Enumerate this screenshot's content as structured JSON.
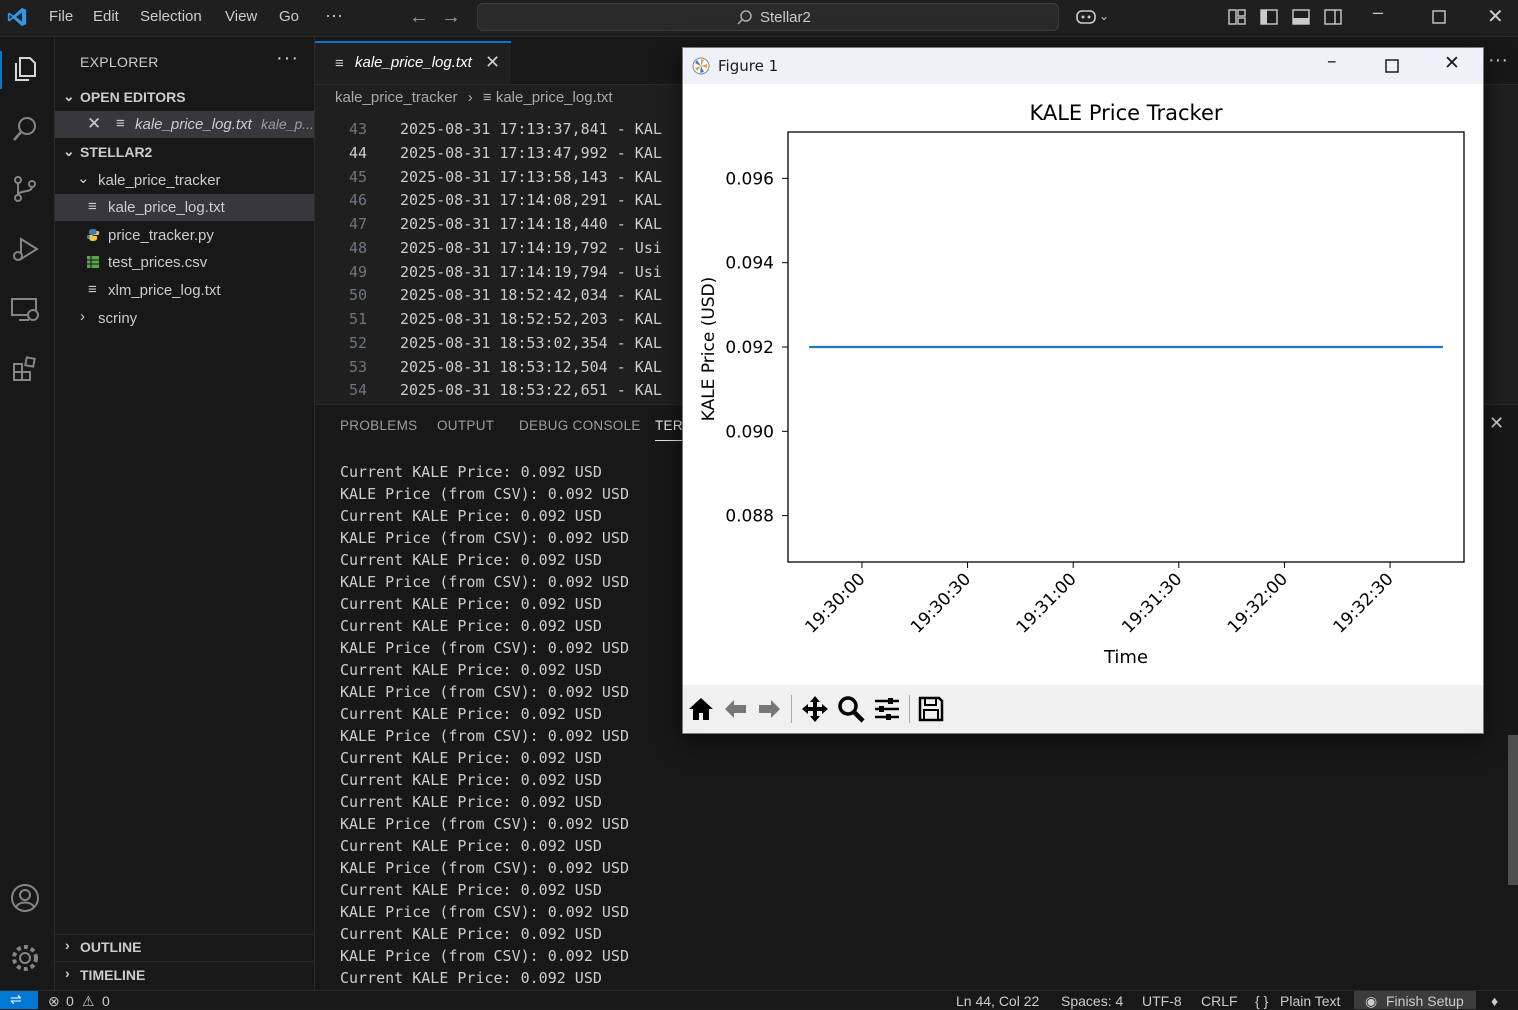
{
  "titlebar": {
    "menus": [
      "File",
      "Edit",
      "Selection",
      "View",
      "Go"
    ],
    "more": "···",
    "search_text": "Stellar2"
  },
  "sidebar": {
    "title": "EXPLORER",
    "more": "···",
    "open_editors_label": "OPEN EDITORS",
    "open_editor": {
      "name": "kale_price_log.txt",
      "hint": "kale_p..."
    },
    "workspace_label": "STELLAR2",
    "tree": {
      "folder": "kale_price_tracker",
      "files": [
        "kale_price_log.txt",
        "price_tracker.py",
        "test_prices.csv",
        "xlm_price_log.txt"
      ],
      "collapsed_folder": "scriny"
    },
    "outline_label": "OUTLINE",
    "timeline_label": "TIMELINE"
  },
  "editor": {
    "tab_label": "kale_price_log.txt",
    "breadcrumb": {
      "folder": "kale_price_tracker",
      "file": "kale_price_log.txt"
    },
    "lines": [
      {
        "n": "43",
        "text": "2025-08-31 17:13:37,841 - KAL"
      },
      {
        "n": "44",
        "text": "2025-08-31 17:13:47,992 - KAL"
      },
      {
        "n": "45",
        "text": "2025-08-31 17:13:58,143 - KAL"
      },
      {
        "n": "46",
        "text": "2025-08-31 17:14:08,291 - KAL"
      },
      {
        "n": "47",
        "text": "2025-08-31 17:14:18,440 - KAL"
      },
      {
        "n": "48",
        "text": "2025-08-31 17:14:19,792 - Usi"
      },
      {
        "n": "49",
        "text": "2025-08-31 17:14:19,794 - Usi"
      },
      {
        "n": "50",
        "text": "2025-08-31 18:52:42,034 - KAL"
      },
      {
        "n": "51",
        "text": "2025-08-31 18:52:52,203 - KAL"
      },
      {
        "n": "52",
        "text": "2025-08-31 18:53:02,354 - KAL"
      },
      {
        "n": "53",
        "text": "2025-08-31 18:53:12,504 - KAL"
      },
      {
        "n": "54",
        "text": "2025-08-31 18:53:22,651 - KAL"
      }
    ]
  },
  "panel": {
    "tabs": [
      "PROBLEMS",
      "OUTPUT",
      "DEBUG CONSOLE",
      "TERM"
    ],
    "terminal_lines": [
      "Current KALE Price: 0.092 USD",
      "KALE Price (from CSV): 0.092 USD",
      "Current KALE Price: 0.092 USD",
      "KALE Price (from CSV): 0.092 USD",
      "Current KALE Price: 0.092 USD",
      "KALE Price (from CSV): 0.092 USD",
      "Current KALE Price: 0.092 USD",
      "Current KALE Price: 0.092 USD",
      "KALE Price (from CSV): 0.092 USD",
      "Current KALE Price: 0.092 USD",
      "KALE Price (from CSV): 0.092 USD",
      "Current KALE Price: 0.092 USD",
      "KALE Price (from CSV): 0.092 USD",
      "Current KALE Price: 0.092 USD",
      "Current KALE Price: 0.092 USD",
      "Current KALE Price: 0.092 USD",
      "KALE Price (from CSV): 0.092 USD",
      "Current KALE Price: 0.092 USD",
      "KALE Price (from CSV): 0.092 USD",
      "Current KALE Price: 0.092 USD",
      "KALE Price (from CSV): 0.092 USD",
      "Current KALE Price: 0.092 USD",
      "KALE Price (from CSV): 0.092 USD",
      "Current KALE Price: 0.092 USD"
    ]
  },
  "statusbar": {
    "errors": "0",
    "warnings": "0",
    "position": "Ln 44, Col 22",
    "spaces": "Spaces: 4",
    "encoding": "UTF-8",
    "eol": "CRLF",
    "language": "Plain Text",
    "language_icon": "{ }",
    "finish_setup": "Finish Setup"
  },
  "figure": {
    "window_title": "Figure 1",
    "colors": {
      "line": "#1f77b4"
    }
  },
  "chart_data": {
    "type": "line",
    "title": "KALE Price Tracker",
    "xlabel": "Time",
    "ylabel": "KALE Price (USD)",
    "x": [
      "19:29:45",
      "19:32:45"
    ],
    "series": [
      {
        "values": [
          0.092,
          0.092
        ]
      }
    ],
    "x_range": [
      "19:29:39",
      "19:32:51"
    ],
    "ylim": [
      0.0869,
      0.0971
    ],
    "xticks": [
      "19:30:00",
      "19:30:30",
      "19:31:00",
      "19:31:30",
      "19:32:00",
      "19:32:30"
    ],
    "yticks": [
      "0.088",
      "0.090",
      "0.092",
      "0.094",
      "0.096"
    ],
    "grid": false
  }
}
